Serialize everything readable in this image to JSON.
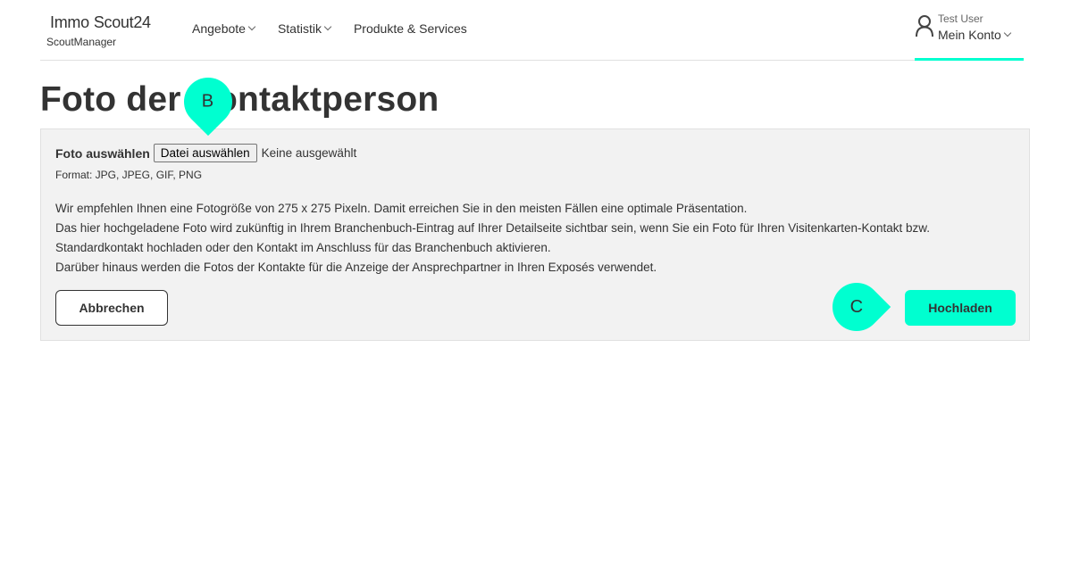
{
  "header": {
    "logo_immo": "Immo",
    "logo_scout": "Scout24",
    "logo_sub": "ScoutManager",
    "nav": [
      {
        "label": "Angebote"
      },
      {
        "label": "Statistik"
      },
      {
        "label": "Produkte & Services"
      }
    ],
    "account": {
      "user": "Test User",
      "label": "Mein Konto"
    }
  },
  "page": {
    "title": "Foto der Kontaktperson"
  },
  "form": {
    "file_label": "Foto auswählen",
    "file_button": "Datei auswählen",
    "file_status": "Keine ausgewählt",
    "format": "Format: JPG, JPEG, GIF, PNG",
    "info_lines": [
      "Wir empfehlen Ihnen eine Fotogröße von 275 x 275 Pixeln. Damit erreichen Sie in den meisten Fällen eine optimale Präsentation.",
      "Das hier hochgeladene Foto wird zukünftig in Ihrem Branchenbuch-Eintrag auf Ihrer Detailseite sichtbar sein, wenn Sie ein Foto für Ihren Visitenkarten-Kontakt bzw.",
      "Standardkontakt hochladen oder den Kontakt im Anschluss für das Branchenbuch aktivieren.",
      "Darüber hinaus werden die Fotos der Kontakte für die Anzeige der Ansprechpartner in Ihren Exposés verwendet."
    ],
    "cancel_button": "Abbrechen",
    "upload_button": "Hochladen"
  },
  "markers": {
    "b": "B",
    "c": "C"
  },
  "colors": {
    "accent": "#00ffd0",
    "panel_bg": "#f2f2f2",
    "text": "#333333"
  }
}
